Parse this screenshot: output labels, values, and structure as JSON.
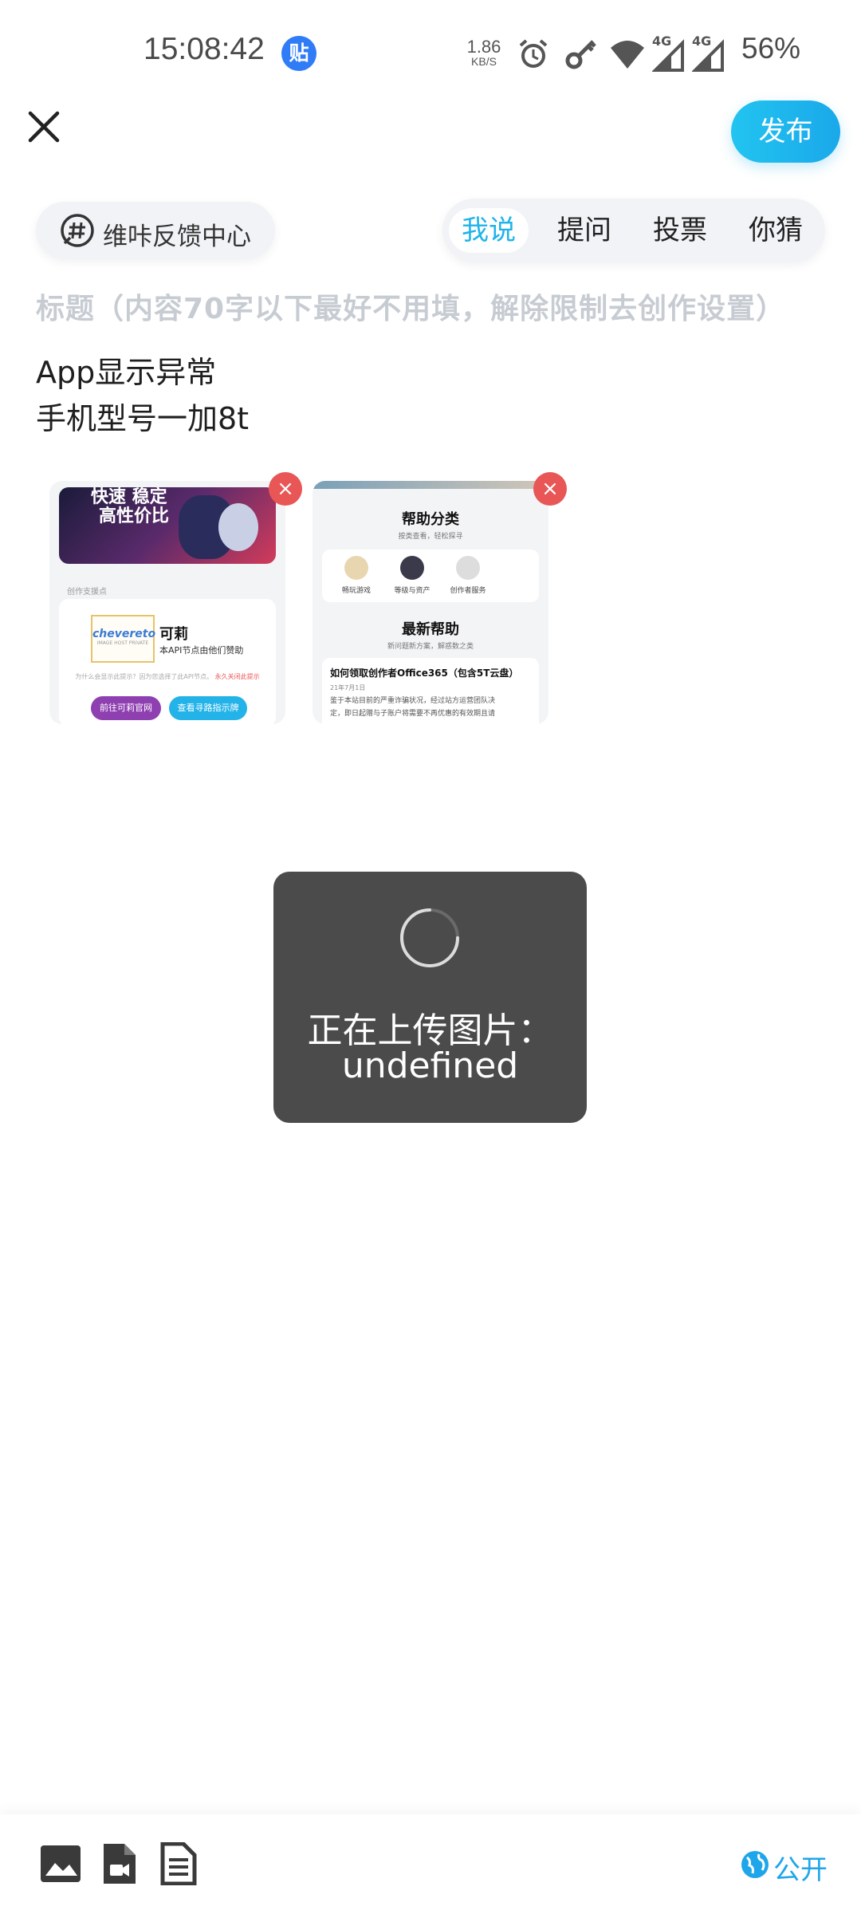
{
  "status_bar": {
    "time": "15:08:42",
    "app_badge": "贴",
    "net_speed_value": "1.86",
    "net_speed_unit": "KB/S",
    "signal_labels": [
      "4G",
      "4G"
    ],
    "battery": "56%"
  },
  "header": {
    "publish_label": "发布"
  },
  "topic": {
    "label": "维咔反馈中心"
  },
  "mode_tabs": [
    {
      "label": "我说",
      "active": true
    },
    {
      "label": "提问",
      "active": false
    },
    {
      "label": "投票",
      "active": false
    },
    {
      "label": "你猜",
      "active": false
    }
  ],
  "editor": {
    "title_placeholder": "标题（内容70字以下最好不用填，解除限制去创作设置）",
    "body_lines": [
      "App显示异常",
      "手机型号一加8t"
    ]
  },
  "attachments": [
    {
      "banner_text_1": "快速 稳定",
      "banner_text_2": "高性价比",
      "section_label": "创作支援点",
      "logo_text": "chevereto",
      "logo_sub": "IMAGE HOST PRIVATE",
      "name": "可莉",
      "desc": "本API节点由他们赞助",
      "note": "为什么会显示此提示？因为您选择了此API节点。",
      "note_link": "永久关闭此提示",
      "btn_1": "前往可莉官网",
      "btn_2": "查看寻路指示牌",
      "remove_label": "×"
    },
    {
      "heading_1": "帮助分类",
      "sub_1": "按类查看，轻松探寻",
      "categories": [
        "畅玩游戏",
        "等级与资产",
        "创作者服务"
      ],
      "heading_2": "最新帮助",
      "sub_2": "新问题新方案，解惑数之类",
      "article_title": "如何领取创作者Office365（包含5T云盘）",
      "article_date": "21年7月1日",
      "article_text_1": "鉴于本站目前的严重诈骗状况，经过站方运营团队决",
      "article_text_2": "定，即日起赠与子账户将需要不再优惠的有效期且请",
      "remove_label": "×"
    }
  ],
  "toast": {
    "line_1": "正在上传图片：",
    "line_2": "undefined"
  },
  "toolbar": {
    "icons": [
      "image-icon",
      "video-file-icon",
      "document-icon"
    ],
    "privacy_label": "公开"
  },
  "colors": {
    "accent": "#1fb3ea",
    "toast_bg": "#4b4b4b",
    "remove_red": "#e85656",
    "placeholder": "#c7ccd3"
  }
}
